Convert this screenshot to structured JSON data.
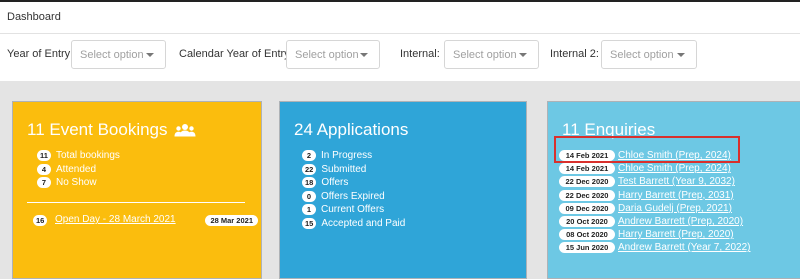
{
  "header": {
    "title": "Dashboard"
  },
  "filters": [
    {
      "label": "Year of Entry:",
      "placeholder": "Select option"
    },
    {
      "label": "Calendar Year of Entry:",
      "placeholder": "Select option"
    },
    {
      "label": "Internal:",
      "placeholder": "Select option"
    },
    {
      "label": "Internal 2:",
      "placeholder": "Select option"
    }
  ],
  "colors": {
    "yellow": "#fbbd0d",
    "blue": "#2fa5d8",
    "lightblue": "#6dc8e4",
    "highlight": "#d9302c"
  },
  "events_card": {
    "title": "11 Event Bookings",
    "icon": "users-icon",
    "stats": [
      {
        "count": "11",
        "label": "Total bookings"
      },
      {
        "count": "4",
        "label": "Attended"
      },
      {
        "count": "7",
        "label": "No Show"
      }
    ],
    "event": {
      "count": "16",
      "name": "Open Day - 28 March 2021",
      "date": "28 Mar 2021"
    }
  },
  "applications_card": {
    "title": "24 Applications",
    "stats": [
      {
        "count": "2",
        "label": "In Progress"
      },
      {
        "count": "22",
        "label": "Submitted"
      },
      {
        "count": "18",
        "label": "Offers"
      },
      {
        "count": "0",
        "label": "Offers Expired"
      },
      {
        "count": "1",
        "label": "Current Offers"
      },
      {
        "count": "15",
        "label": "Accepted and Paid"
      }
    ]
  },
  "enquiries_card": {
    "title": "11 Enquiries",
    "items": [
      {
        "date": "14 Feb 2021",
        "name": "Chloe Smith (Prep, 2024)"
      },
      {
        "date": "14 Feb 2021",
        "name": "Chloe Smith (Prep, 2024)"
      },
      {
        "date": "22 Dec 2020",
        "name": "Test Barrett (Year 9, 2032)"
      },
      {
        "date": "22 Dec 2020",
        "name": "Harry Barrett (Prep, 2031)"
      },
      {
        "date": "09 Dec 2020",
        "name": "Daria Gudelj (Prep, 2021)"
      },
      {
        "date": "20 Oct 2020",
        "name": "Andrew Barrett (Prep, 2020)"
      },
      {
        "date": "08 Oct 2020",
        "name": "Harry Barrett (Prep, 2020)"
      },
      {
        "date": "15 Jun 2020",
        "name": "Andrew Barrett (Year 7, 2022)"
      }
    ]
  }
}
